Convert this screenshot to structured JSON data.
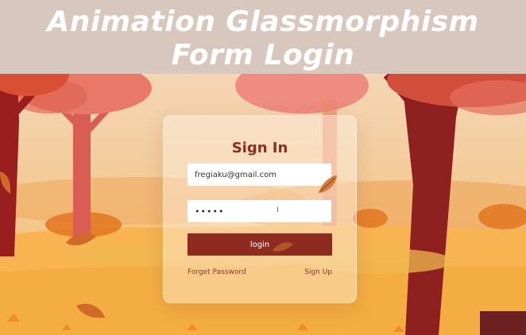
{
  "banner": {
    "line1": "Animation Glassmorphism",
    "line2": "Form Login"
  },
  "form": {
    "title": "Sign In",
    "email_value": "fregiaku@gmail.com",
    "password_value": "•••••",
    "login_label": "login",
    "forget_label": "Forget Password",
    "signup_label": "Sign Up"
  },
  "colors": {
    "banner_bg": "#d8c7bd",
    "accent": "#8f2a20",
    "title": "#8b2f22",
    "sky": "#f1d8b8"
  },
  "icons": [
    "cursor-icon",
    "autumn-leaf-icon"
  ]
}
